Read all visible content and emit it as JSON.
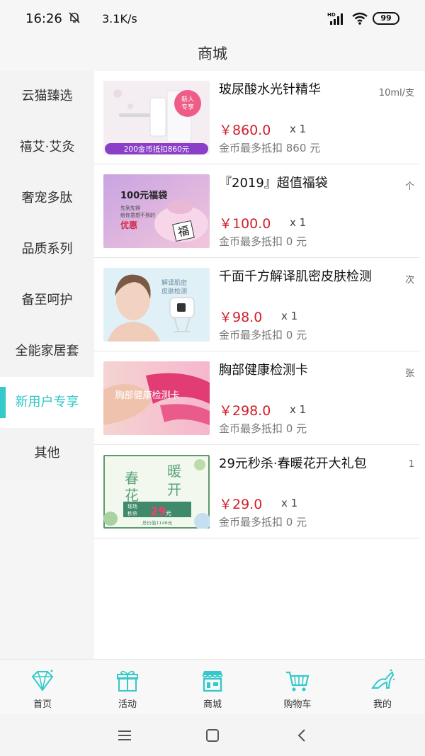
{
  "status": {
    "time": "16:26",
    "speed": "3.1K/s",
    "battery": "99",
    "network": "HD"
  },
  "header": {
    "title": "商城"
  },
  "sidebar": {
    "items": [
      {
        "label": "云猫臻选"
      },
      {
        "label": "禧艾·艾灸"
      },
      {
        "label": "奢宠多肽"
      },
      {
        "label": "品质系列"
      },
      {
        "label": "备至呵护"
      },
      {
        "label": "全能家居套"
      },
      {
        "label": "新用户专享",
        "active": true
      },
      {
        "label": "其他"
      }
    ]
  },
  "products": [
    {
      "name": "玻尿酸水光针精华",
      "unit": "10ml/支",
      "price": "￥860.0",
      "qty": "x 1",
      "coin": "金币最多抵扣 860 元",
      "image": {
        "badge": "新人专享",
        "banner": "200金币抵扣860元"
      }
    },
    {
      "name": "『2019』超值福袋",
      "unit": "个",
      "price": "￥100.0",
      "qty": "x 1",
      "coin": "金币最多抵扣 0 元",
      "image": {
        "title": "100元福袋",
        "line1": "先到先得",
        "line2": "给你意想不到的",
        "line3": "优惠",
        "seal": "福"
      }
    },
    {
      "name": "千面千方解译肌密皮肤检测",
      "unit": "次",
      "price": "￥98.0",
      "qty": "x 1",
      "coin": "金币最多抵扣 0 元",
      "image": {
        "line1": "解译肌密",
        "line2": "皮肤检测"
      }
    },
    {
      "name": "胸部健康检测卡",
      "unit": "张",
      "price": "￥298.0",
      "qty": "x 1",
      "coin": "金币最多抵扣 0 元",
      "image": {
        "title": "胸部健康检测卡"
      }
    },
    {
      "name": "29元秒杀·春暖花开大礼包",
      "unit": "1",
      "price": "￥29.0",
      "qty": "x 1",
      "coin": "金币最多抵扣 0 元",
      "image": {
        "c1": "春",
        "c2": "暖",
        "c3": "花",
        "c4": "开",
        "tag1": "现场",
        "tag2": "秒杀",
        "big": "29",
        "yuan": "元",
        "total": "总价值1146元"
      }
    }
  ],
  "tabbar": {
    "tabs": [
      {
        "label": "首页",
        "icon": "diamond-icon"
      },
      {
        "label": "活动",
        "icon": "gift-icon"
      },
      {
        "label": "商城",
        "icon": "shop-icon",
        "active": true
      },
      {
        "label": "购物车",
        "icon": "cart-icon"
      },
      {
        "label": "我的",
        "icon": "high-heel-icon"
      }
    ]
  },
  "colors": {
    "accent": "#35c9cb",
    "price": "#d0202a"
  }
}
